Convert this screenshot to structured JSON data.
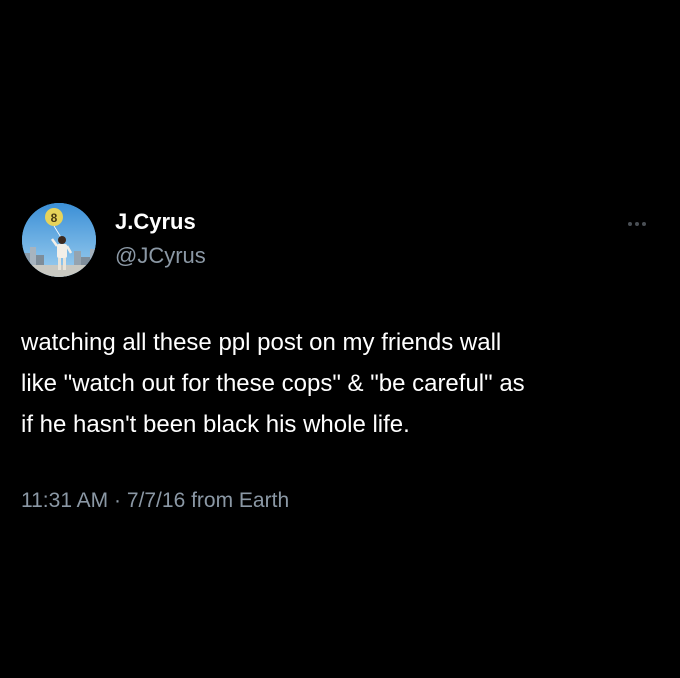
{
  "author": {
    "display_name": "J.Cyrus",
    "handle": "@JCyrus",
    "avatar_badge": "8"
  },
  "tweet": {
    "text": "watching all these ppl post on my friends wall\nlike \"watch out for these cops\" & \"be careful\" as\nif he hasn't been black his whole life.",
    "time": "11:31 AM",
    "separator": "·",
    "date": "7/7/16",
    "source": "from Earth"
  },
  "icons": {
    "more": "more-options-icon"
  },
  "colors": {
    "background": "#000000",
    "primary_text": "#ffffff",
    "secondary_text": "#8b98a5"
  }
}
